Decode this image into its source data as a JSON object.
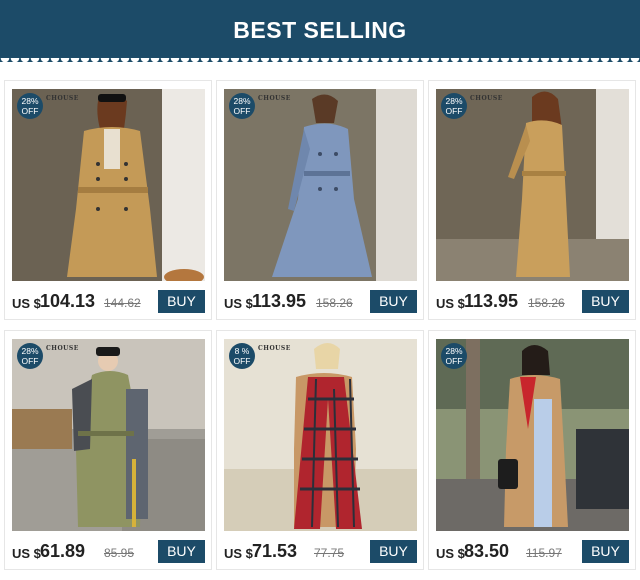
{
  "header": {
    "title": "BEST SELLING"
  },
  "products": [
    {
      "discount_pct": "28%",
      "discount_off": "OFF",
      "brand": "CHOUSE",
      "currency": "US $",
      "price": "104.13",
      "old_price": "144.62",
      "buy_label": "BUY",
      "colors": {
        "bg": "#6b6253",
        "wall": "#ece9e4",
        "coat": "#c49a57"
      }
    },
    {
      "discount_pct": "28%",
      "discount_off": "OFF",
      "brand": "CHOUSE",
      "currency": "US $",
      "price": "113.95",
      "old_price": "158.26",
      "buy_label": "BUY",
      "colors": {
        "bg": "#7c7565",
        "wall": "#dedad3",
        "coat": "#7f97bd"
      }
    },
    {
      "discount_pct": "28%",
      "discount_off": "OFF",
      "brand": "CHOUSE",
      "currency": "US $",
      "price": "113.95",
      "old_price": "158.26",
      "buy_label": "BUY",
      "colors": {
        "bg": "#6f6656",
        "wall": "#e3dfd8",
        "coat": "#c99f5c"
      }
    },
    {
      "discount_pct": "28%",
      "discount_off": "OFF",
      "brand": "CHOUSE",
      "currency": "US $",
      "price": "61.89",
      "old_price": "85.95",
      "buy_label": "BUY",
      "colors": {
        "bg": "#a09d96",
        "wall": "#c9c4bb",
        "coat": "#8f9462"
      }
    },
    {
      "discount_pct": "8 %",
      "discount_off": "OFF",
      "brand": "CHOUSE",
      "currency": "US $",
      "price": "71.53",
      "old_price": "77.75",
      "buy_label": "BUY",
      "colors": {
        "bg": "#e6e1d4",
        "wall": "#f1ede4",
        "coat": "#c89866"
      }
    },
    {
      "discount_pct": "28%",
      "discount_off": "OFF",
      "brand": "",
      "currency": "US $",
      "price": "83.50",
      "old_price": "115.97",
      "buy_label": "BUY",
      "colors": {
        "bg": "#5f6a55",
        "wall": "#8a9475",
        "coat": "#c79a68"
      }
    }
  ]
}
